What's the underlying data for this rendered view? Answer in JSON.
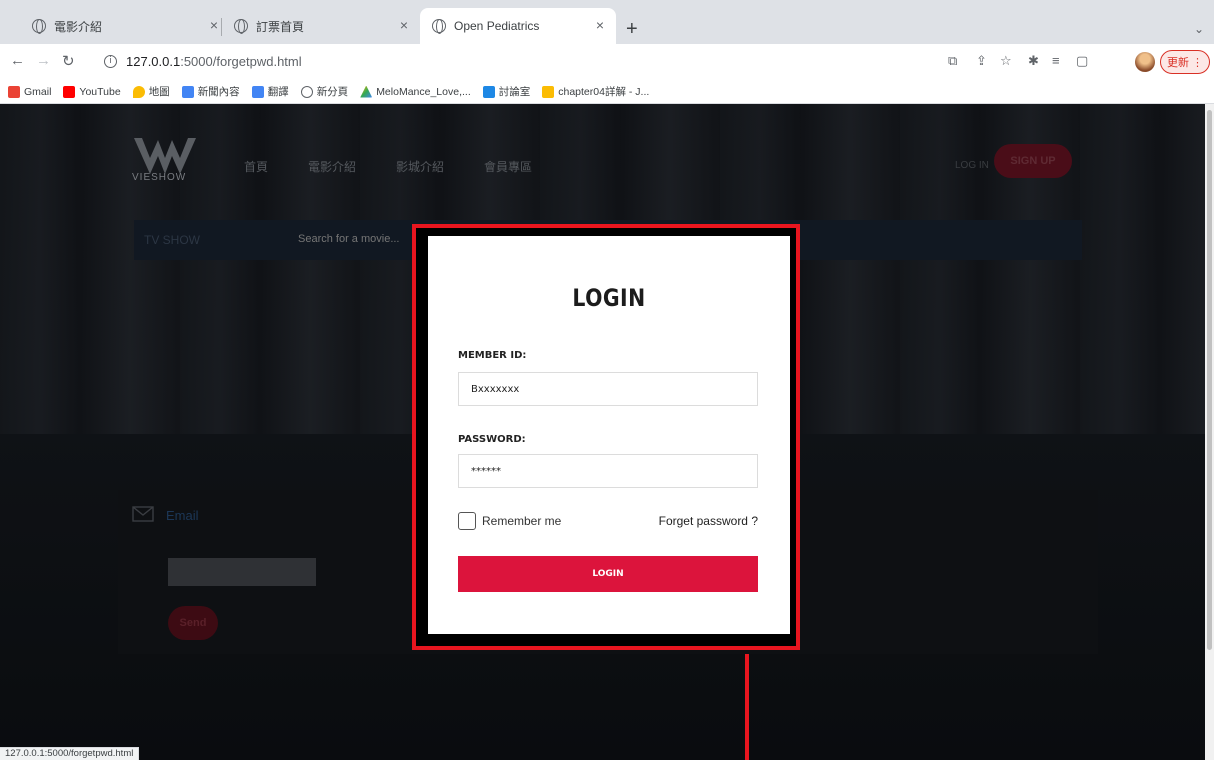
{
  "browser": {
    "tabs": [
      {
        "title": "電影介紹",
        "active": false
      },
      {
        "title": "訂票首頁",
        "active": false
      },
      {
        "title": "Open Pediatrics",
        "active": true
      }
    ],
    "url_host": "127.0.0.1",
    "url_path": ":5000/forgetpwd.html",
    "update_label": "更新",
    "bookmarks": [
      {
        "label": "Gmail",
        "color": "#ea4335"
      },
      {
        "label": "YouTube",
        "color": "#ff0000"
      },
      {
        "label": "地圖",
        "color": "#fbbc04"
      },
      {
        "label": "新聞內容",
        "color": "#4285f4"
      },
      {
        "label": "翻譯",
        "color": "#4285f4"
      },
      {
        "label": "新分頁",
        "color": "#5f6368"
      },
      {
        "label": "MeloMance_Love,...",
        "color": "#34a853"
      },
      {
        "label": "討論室",
        "color": "#1e88e5"
      },
      {
        "label": "chapter04詳解 - J...",
        "color": "#fbbc04"
      }
    ],
    "status_url": "127.0.0.1:5000/forgetpwd.html"
  },
  "site": {
    "logo_text": "VIESHOW",
    "nav": [
      "首頁",
      "電影介紹",
      "影城介紹",
      "會員專區"
    ],
    "login_link": "LOG IN",
    "signup": "SIGN UP",
    "search_category": "TV SHOW",
    "search_placeholder": "Search for a movie...",
    "email_label": "Email",
    "send_label": "Send"
  },
  "modal": {
    "title": "LOGIN",
    "member_label": "MEMBER ID:",
    "member_value": "Bxxxxxxx",
    "password_label": "PASSWORD:",
    "password_value": "******",
    "remember_label": "Remember me",
    "forget_label": "Forget password ?",
    "login_button": "LOGIN",
    "accent": "#dc143c",
    "highlight": "#e8151f"
  }
}
